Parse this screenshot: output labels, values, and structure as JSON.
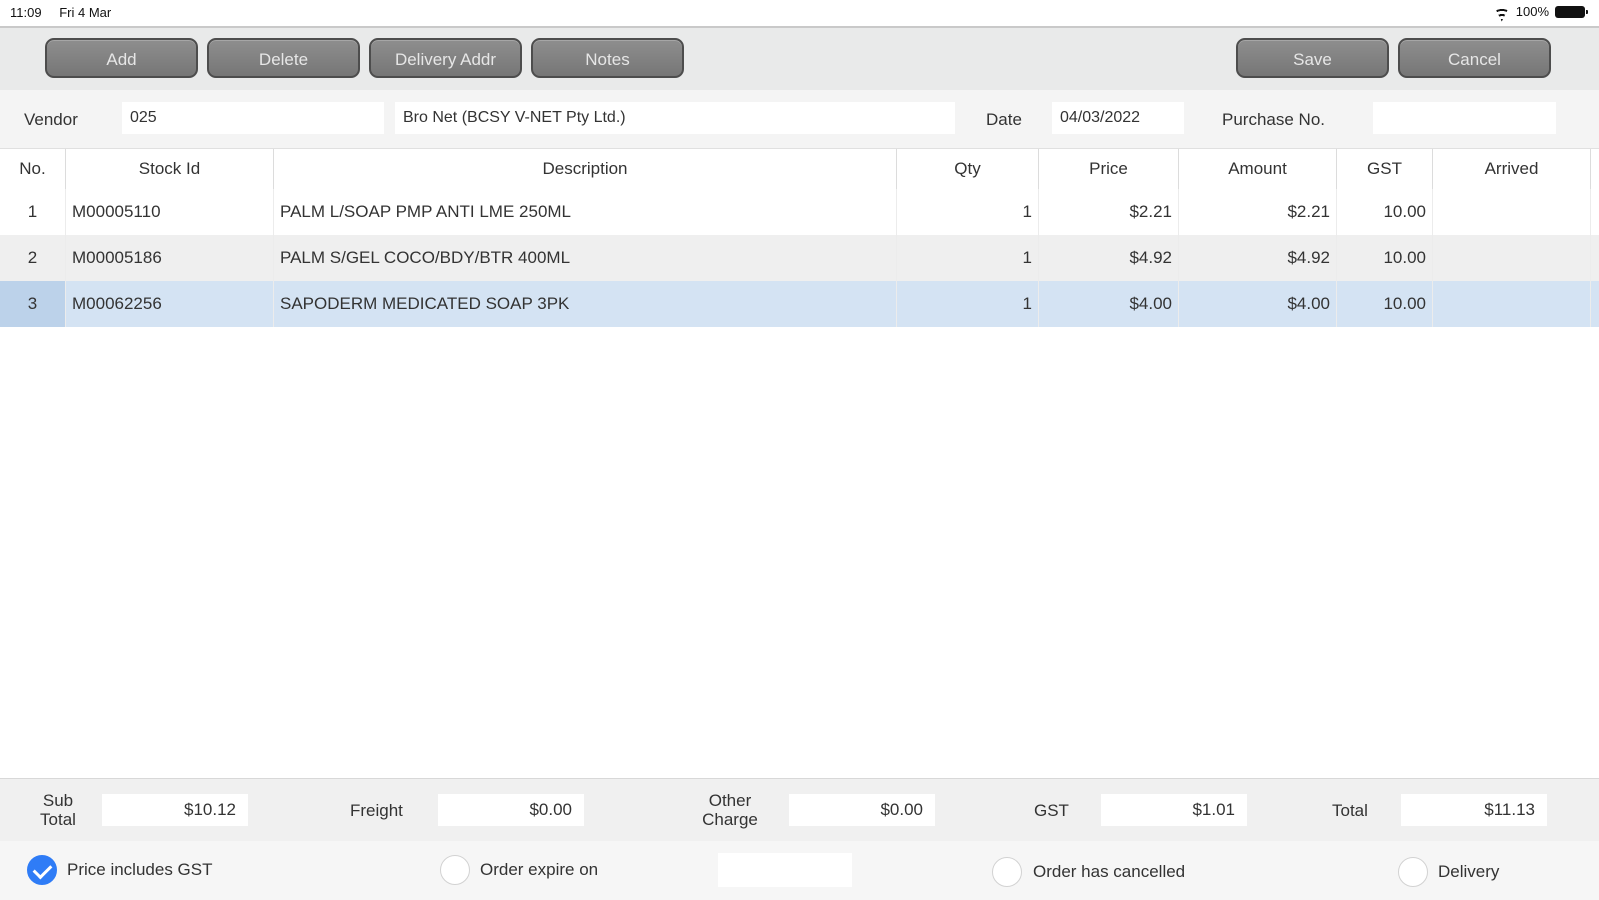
{
  "status": {
    "time": "11:09",
    "date": "Fri 4 Mar",
    "battery": "100%"
  },
  "toolbar": {
    "add": "Add",
    "delete": "Delete",
    "delivery_addr": "Delivery Addr",
    "notes": "Notes",
    "save": "Save",
    "cancel": "Cancel"
  },
  "header": {
    "vendor_label": "Vendor",
    "vendor_code": "025",
    "vendor_name": "Bro Net  (BCSY V-NET Pty Ltd.)",
    "date_label": "Date",
    "date_value": "04/03/2022",
    "purchase_label": "Purchase No.",
    "purchase_value": ""
  },
  "grid": {
    "columns": [
      "No.",
      "Stock Id",
      "Description",
      "Qty",
      "Price",
      "Amount",
      "GST",
      "Arrived"
    ],
    "rows": [
      {
        "no": "1",
        "stock_id": "M00005110",
        "description": "PALM L/SOAP PMP ANTI LME 250ML",
        "qty": "1",
        "price": "$2.21",
        "amount": "$2.21",
        "gst": "10.00",
        "arrived": ""
      },
      {
        "no": "2",
        "stock_id": "M00005186",
        "description": "PALM S/GEL COCO/BDY/BTR  400ML",
        "qty": "1",
        "price": "$4.92",
        "amount": "$4.92",
        "gst": "10.00",
        "arrived": ""
      },
      {
        "no": "3",
        "stock_id": "M00062256",
        "description": "SAPODERM MEDICATED SOAP    3PK",
        "qty": "1",
        "price": "$4.00",
        "amount": "$4.00",
        "gst": "10.00",
        "arrived": ""
      }
    ],
    "selected_row": 3
  },
  "totals": {
    "subtotal_label_1": "Sub",
    "subtotal_label_2": "Total",
    "subtotal": "$10.12",
    "freight_label": "Freight",
    "freight": "$0.00",
    "other_label_1": "Other",
    "other_label_2": "Charge",
    "other": "$0.00",
    "gst_label": "GST",
    "gst": "$1.01",
    "total_label": "Total",
    "total": "$11.13"
  },
  "options": {
    "price_includes_gst": "Price includes GST",
    "price_includes_gst_checked": true,
    "order_expire_on": "Order expire on",
    "order_expire_value": "",
    "order_cancelled": "Order has cancelled",
    "delivery": "Delivery"
  },
  "colors": {
    "accent": "#2f7cf6",
    "selected_row": "#d4e3f3",
    "alt_row": "#efefef",
    "button": "#7f7f7f"
  }
}
